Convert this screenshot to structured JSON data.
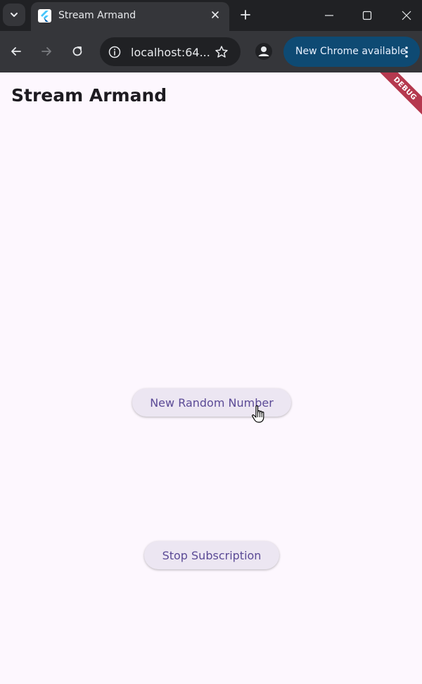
{
  "browser": {
    "tab": {
      "title": "Stream Armand"
    },
    "address_bar": {
      "url": "localhost:64..."
    },
    "update_button": {
      "label": "New Chrome available"
    }
  },
  "app": {
    "title": "Stream Armand",
    "debug_banner": "DEBUG",
    "buttons": {
      "random_number": "New Random Number",
      "stop_subscription": "Stop Subscription"
    }
  },
  "icons": {
    "tab_search": "chevron-down-icon",
    "favicon": "flutter-logo-icon",
    "tab_close": "close-icon",
    "new_tab": "plus-icon",
    "back": "arrow-left-icon",
    "forward": "arrow-right-icon",
    "reload": "reload-icon",
    "site_info": "info-icon",
    "bookmark": "star-icon",
    "profile": "person-icon",
    "menu": "more-vert-icon",
    "cursor": "hand-pointer-icon"
  },
  "colors": {
    "app_background": "#fdf7fe",
    "button_background": "#ece6f2",
    "button_text": "#5b4a96",
    "debug_ribbon": "#b5394f",
    "chrome_update": "#0e4a73"
  }
}
